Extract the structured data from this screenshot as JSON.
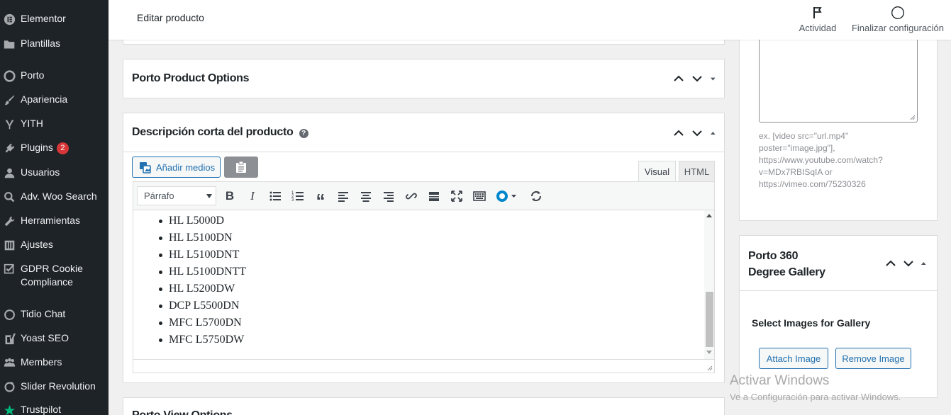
{
  "topbar": {
    "page_title": "Editar producto",
    "activity_label": "Actividad",
    "finish_label": "Finalizar configuración"
  },
  "sidebar": {
    "items": [
      {
        "label": "Elementor",
        "icon": "elementor-icon"
      },
      {
        "label": "Plantillas",
        "icon": "folder-icon"
      },
      {
        "label": "Porto",
        "icon": "porto-icon"
      },
      {
        "label": "Apariencia",
        "icon": "paintbrush-icon"
      },
      {
        "label": "YITH",
        "icon": "yith-icon"
      },
      {
        "label": "Plugins",
        "icon": "plugin-icon",
        "badge": "2"
      },
      {
        "label": "Usuarios",
        "icon": "user-icon"
      },
      {
        "label": "Adv. Woo Search",
        "icon": "search-icon"
      },
      {
        "label": "Herramientas",
        "icon": "wrench-icon"
      },
      {
        "label": "Ajustes",
        "icon": "settings-icon"
      },
      {
        "label": "GDPR Cookie Compliance",
        "icon": "checkbox-icon"
      },
      {
        "label": "Tidio Chat",
        "icon": "chat-icon"
      },
      {
        "label": "Yoast SEO",
        "icon": "yoast-icon"
      },
      {
        "label": "Members",
        "icon": "members-icon"
      },
      {
        "label": "Slider Revolution",
        "icon": "refresh-icon"
      },
      {
        "label": "Trustpilot",
        "icon": "star-icon"
      }
    ]
  },
  "panels": {
    "porto_options_title": "Porto Product Options",
    "short_desc_title": "Descripción corta del producto",
    "porto_view_title": "Porto View Options",
    "gallery_title_line1": "Porto 360",
    "gallery_title_line2": "Degree Gallery"
  },
  "editor": {
    "add_media_label": "Añadir medios",
    "tab_visual": "Visual",
    "tab_html": "HTML",
    "format_value": "Párrafo",
    "list_items": [
      "HL L5000D",
      "HL L5100DN",
      "HL L5100DNT",
      "HL L5100DNTT",
      "HL L5200DW",
      "DCP L5500DN",
      "MFC L5700DN",
      "MFC L5750DW"
    ]
  },
  "video": {
    "hint": "ex. [video src=\"url.mp4\" poster=\"image.jpg\"], https://www.youtube.com/watch?v=MDx7RBISqIA or https://vimeo.com/75230326"
  },
  "gallery": {
    "select_label": "Select Images for Gallery",
    "attach_label": "Attach Image",
    "remove_label": "Remove Image"
  },
  "watermark": {
    "line1": "Activar Windows",
    "line2": "Ve a Configuración para activar Windows."
  },
  "colors": {
    "accent": "#2271b1",
    "sidebar_bg": "#1d2327",
    "badge": "#d63638"
  }
}
